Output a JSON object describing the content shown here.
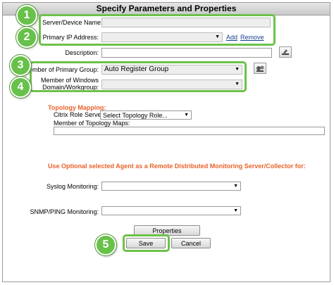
{
  "title": "Specify Parameters and Properties",
  "badges": [
    "1",
    "2",
    "3",
    "4",
    "5"
  ],
  "fields": {
    "server_name_label": "Server/Device Name:",
    "server_name_value": "",
    "primary_ip_label": "Primary IP Address:",
    "primary_ip_value": "",
    "add_link": "Add",
    "remove_link": "Remove",
    "description_label": "Description:",
    "description_value": "",
    "primary_group_label": "Member of Primary Group:",
    "primary_group_value": "Auto Register Group",
    "windows_domain_label_1": "Member of Windows",
    "windows_domain_label_2": "Domain/Workgroup:",
    "windows_domain_value": ""
  },
  "topology": {
    "heading": "Topology Mapping:",
    "citrix_role_label": "Citrix Role Server:",
    "citrix_role_value": "Select Topology Role...",
    "maps_label": "Member of Topology Maps:",
    "maps_value": ""
  },
  "agent": {
    "heading": "Use Optional selected Agent as a Remote Distributed Monitoring Server/Collector for:",
    "syslog_label": "Syslog Monitoring:",
    "syslog_value": "",
    "snmp_label": "SNMP/PING Monitoring:",
    "snmp_value": ""
  },
  "buttons": {
    "properties": "Properties",
    "save": "Save",
    "cancel": "Cancel"
  },
  "colors": {
    "highlight": "#6cc24a",
    "orange_heading": "#e8622b",
    "link": "#1a3e8c"
  }
}
